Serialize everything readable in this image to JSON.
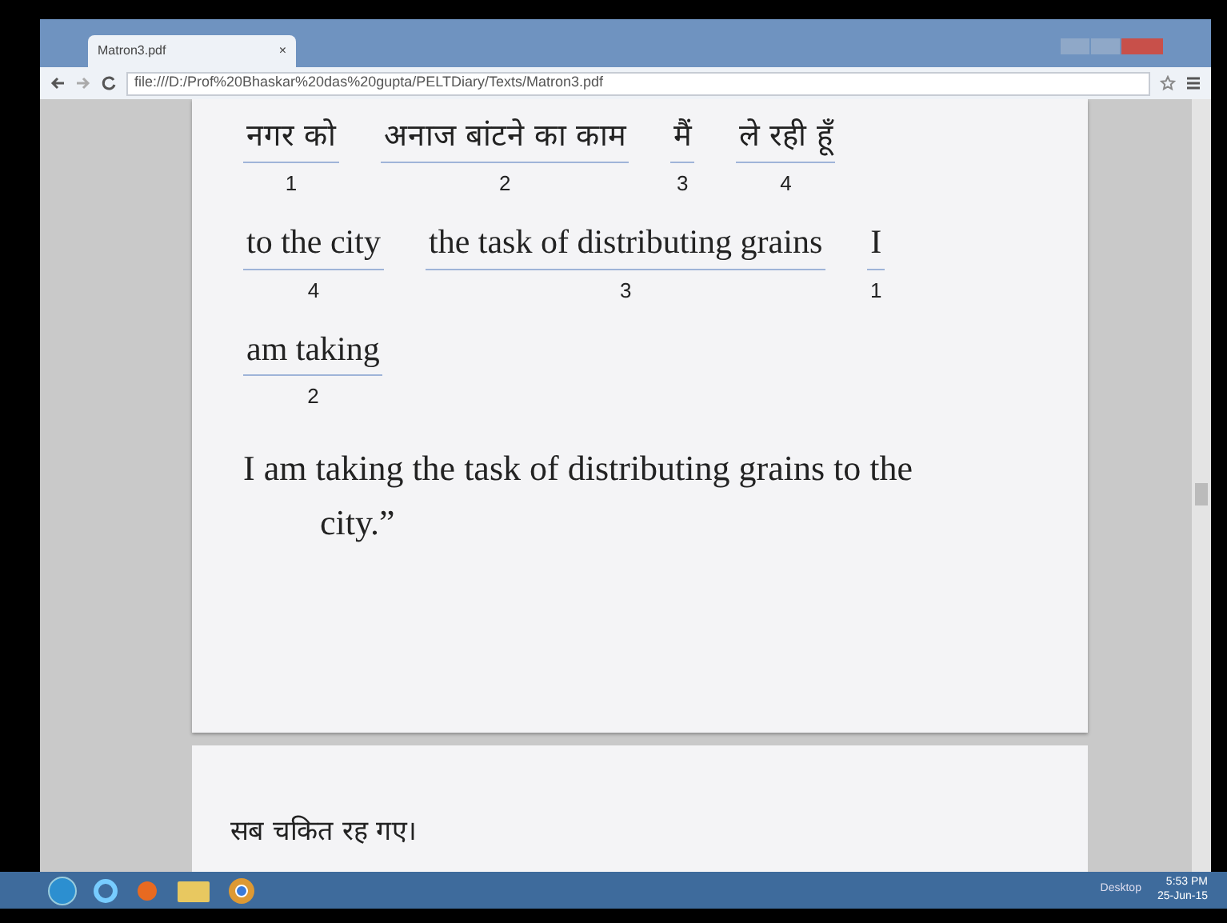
{
  "browser": {
    "tab_title": "Matron3.pdf",
    "tab_close": "×",
    "address": "file:///D:/Prof%20Bhaskar%20das%20gupta/PELTDiary/Texts/Matron3.pdf"
  },
  "page": {
    "hindi_phrases": [
      {
        "text": "नगर को",
        "number": "1"
      },
      {
        "text": "अनाज बांटने का काम",
        "number": "2"
      },
      {
        "text": "मैं",
        "number": "3"
      },
      {
        "text": "ले रही हूँ",
        "number": "4"
      }
    ],
    "english_phrases": [
      {
        "text": "to the city",
        "number": "4"
      },
      {
        "text": "the task of distributing grains",
        "number": "3"
      },
      {
        "text": "I",
        "number": "1"
      },
      {
        "text": "am taking",
        "number": "2"
      }
    ],
    "sentence": "I am taking the task of distributing grains to the city.”"
  },
  "next_page": {
    "text": "सब चकित रह गए।"
  },
  "taskbar": {
    "toolbar_label": "Desktop",
    "time": "5:53 PM",
    "date": "25-Jun-15"
  }
}
